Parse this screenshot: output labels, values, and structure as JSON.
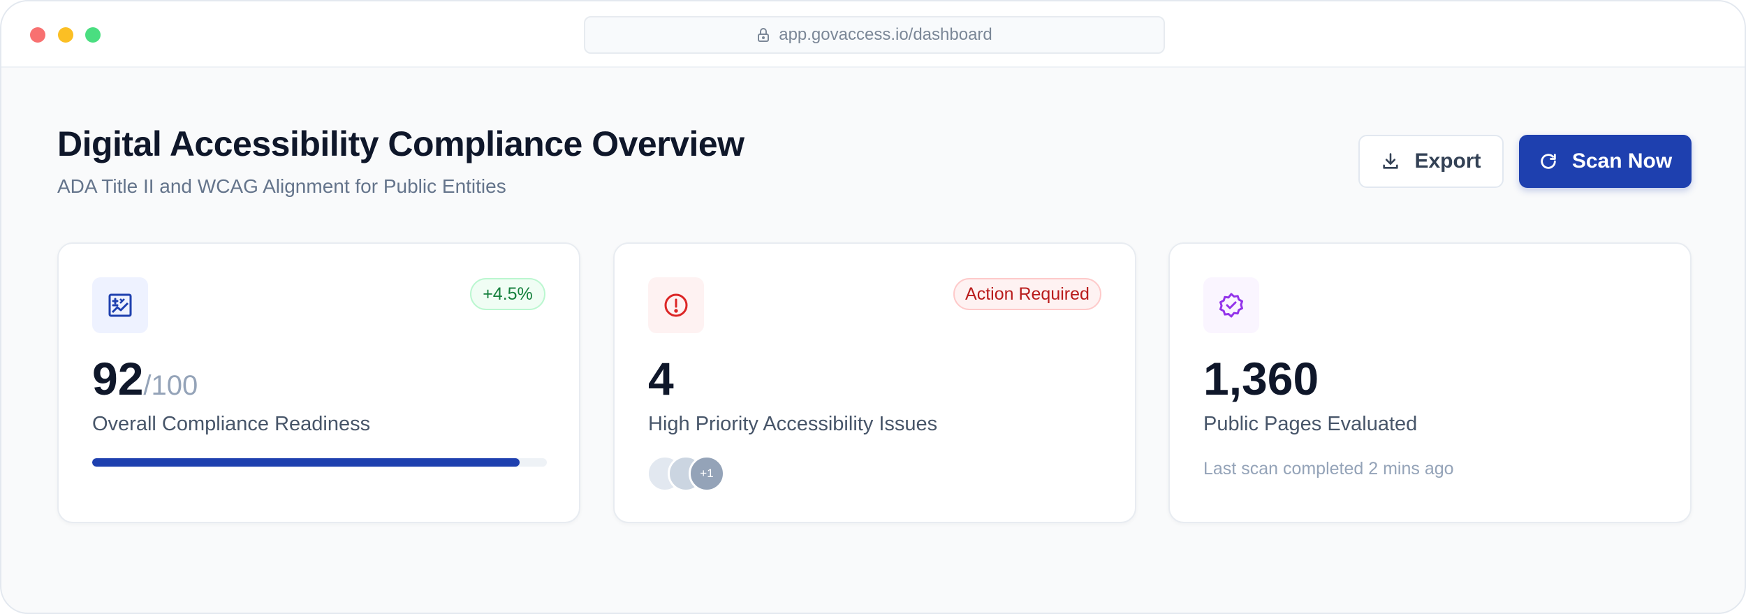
{
  "browser": {
    "url": "app.govaccess.io/dashboard",
    "lock_icon": "lock-icon"
  },
  "header": {
    "title": "Digital Accessibility Compliance Overview",
    "subtitle": "ADA Title II and WCAG Alignment for Public Entities",
    "export_label": "Export",
    "export_icon": "download-icon",
    "scan_label": "Scan Now",
    "scan_icon": "refresh-icon"
  },
  "cards": {
    "readiness": {
      "icon": "chart-icon",
      "badge": "+4.5%",
      "value": "92",
      "suffix": "/100",
      "label": "Overall Compliance Readiness",
      "progress": 0.94
    },
    "issues": {
      "icon": "alert-circle-icon",
      "badge": "Action Required",
      "value": "4",
      "label": "High Priority Accessibility Issues",
      "avatar_more": "+1"
    },
    "pages": {
      "icon": "verified-badge-icon",
      "value": "1,360",
      "label": "Public Pages Evaluated",
      "note": "Last scan completed 2 mins ago"
    }
  },
  "colors": {
    "primary": "#1e40af",
    "success": "#15803d",
    "danger": "#dc2626",
    "purple": "#9333ea"
  }
}
